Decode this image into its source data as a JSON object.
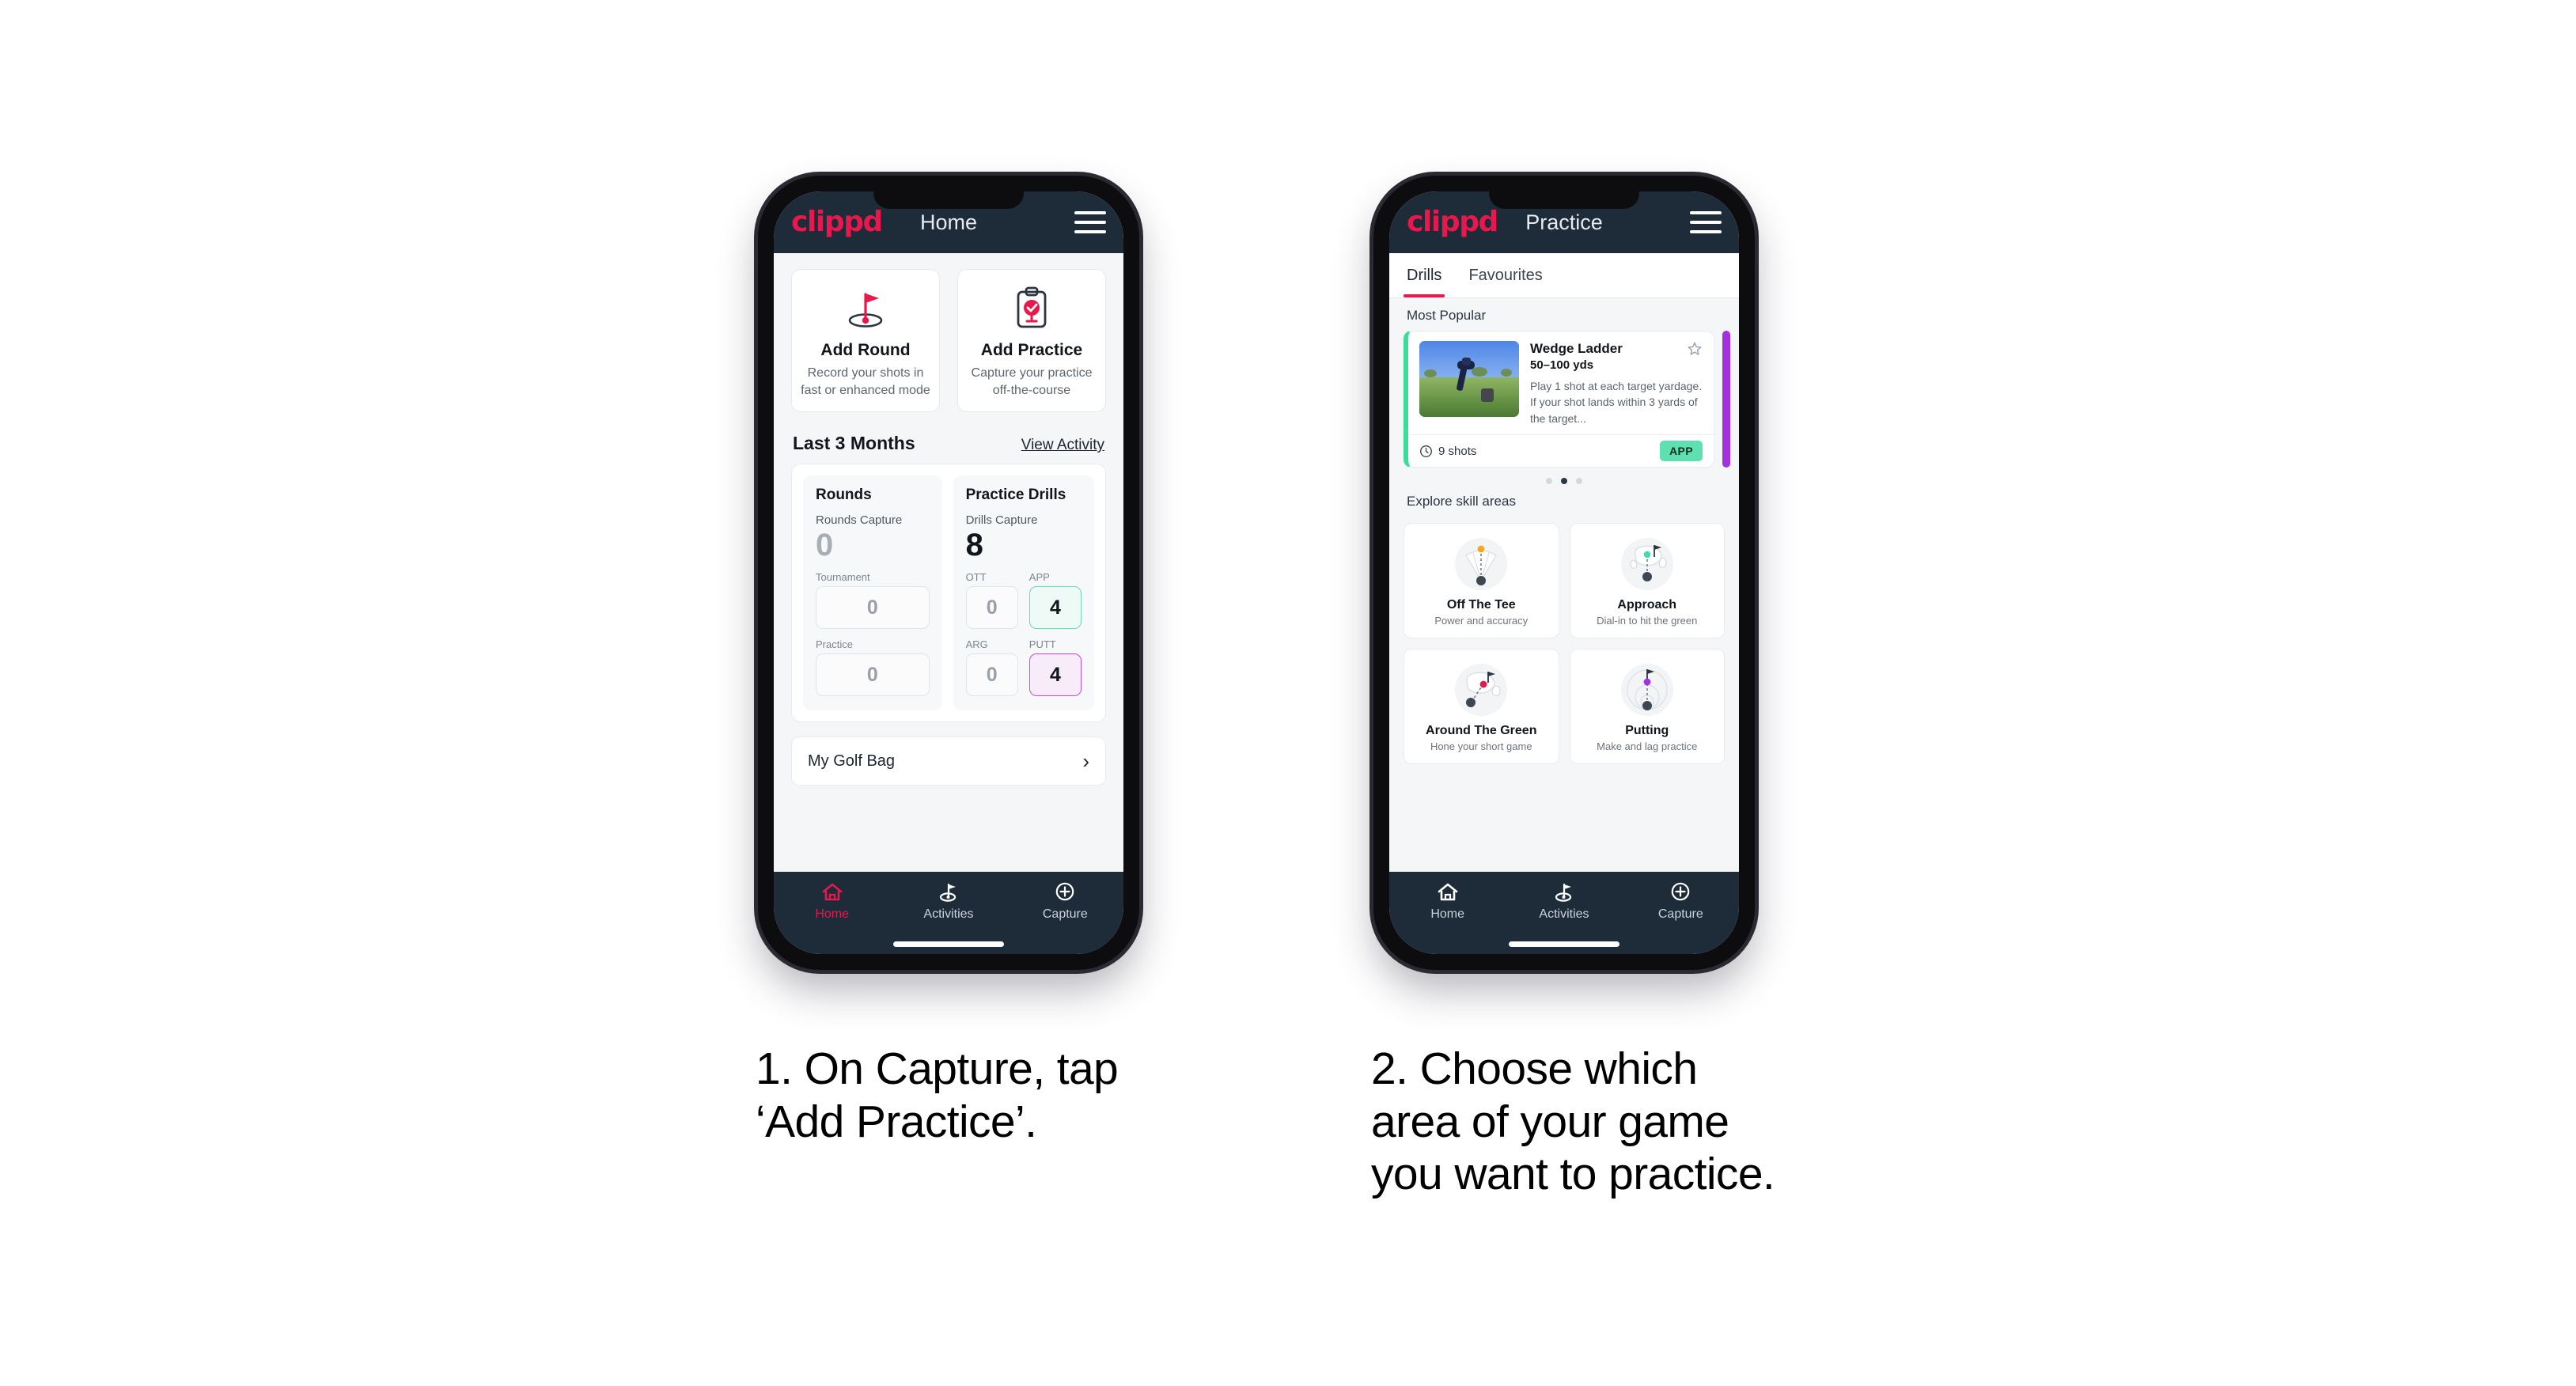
{
  "colors": {
    "brand_pink": "#e8174c",
    "appbar_dark": "#1e2c3a",
    "page_bg": "#f5f6f8",
    "accent_green": "#3ddc9a",
    "accent_purple": "#a431e0",
    "pill_green": "#5fe0b0"
  },
  "phone1": {
    "appbar": {
      "logo": "clippd",
      "title": "Home",
      "menu_icon": "hamburger-menu-icon"
    },
    "quick_actions": [
      {
        "icon": "golf-flag-hole-icon",
        "title": "Add Round",
        "subtitle": "Record your shots in fast or enhanced mode"
      },
      {
        "icon": "clipboard-check-tee-icon",
        "title": "Add Practice",
        "subtitle": "Capture your practice off-the-course"
      }
    ],
    "section": {
      "title": "Last 3 Months",
      "link": "View Activity"
    },
    "stats": {
      "rounds": {
        "heading": "Rounds",
        "capture_label": "Rounds Capture",
        "capture_value": "0",
        "metrics": [
          {
            "label": "Tournament",
            "value": "0",
            "state": "empty"
          },
          {
            "label": "Practice",
            "value": "0",
            "state": "empty"
          }
        ]
      },
      "drills": {
        "heading": "Practice Drills",
        "capture_label": "Drills Capture",
        "capture_value": "8",
        "metrics": [
          {
            "label": "OTT",
            "value": "0",
            "state": "empty"
          },
          {
            "label": "APP",
            "value": "4",
            "state": "green"
          },
          {
            "label": "ARG",
            "value": "0",
            "state": "empty"
          },
          {
            "label": "PUTT",
            "value": "4",
            "state": "purple"
          }
        ]
      }
    },
    "golf_bag": {
      "label": "My Golf Bag",
      "chevron": "chevron-right-icon"
    },
    "bottom_nav": [
      {
        "label": "Home",
        "icon": "home-icon",
        "active": true
      },
      {
        "label": "Activities",
        "icon": "golf-flag-icon",
        "active": false
      },
      {
        "label": "Capture",
        "icon": "plus-circle-icon",
        "active": false
      }
    ]
  },
  "phone2": {
    "appbar": {
      "logo": "clippd",
      "title": "Practice",
      "menu_icon": "hamburger-menu-icon"
    },
    "tabs": [
      {
        "label": "Drills",
        "selected": true
      },
      {
        "label": "Favourites",
        "selected": false
      }
    ],
    "most_popular_label": "Most Popular",
    "drill": {
      "name": "Wedge Ladder",
      "yardage": "50–100 yds",
      "description": "Play 1 shot at each target yardage. If your shot lands within 3 yards of the target...",
      "shots": "9 shots",
      "shots_icon": "clock-icon",
      "tag": "APP",
      "star_icon": "star-outline-icon",
      "thumbnail": "golfer-wedge-shot-photo"
    },
    "carousel_dots": [
      false,
      true,
      false
    ],
    "explore_label": "Explore skill areas",
    "skill_areas": [
      {
        "title": "Off The Tee",
        "subtitle": "Power and accuracy",
        "icon": "tee-shot-dispersion-icon"
      },
      {
        "title": "Approach",
        "subtitle": "Dial-in to hit the green",
        "icon": "approach-green-icon"
      },
      {
        "title": "Around The Green",
        "subtitle": "Hone your short game",
        "icon": "chip-around-green-icon"
      },
      {
        "title": "Putting",
        "subtitle": "Make and lag practice",
        "icon": "putting-rings-icon"
      }
    ],
    "bottom_nav": [
      {
        "label": "Home",
        "icon": "home-icon",
        "active": false
      },
      {
        "label": "Activities",
        "icon": "golf-flag-icon",
        "active": false
      },
      {
        "label": "Capture",
        "icon": "plus-circle-icon",
        "active": false
      }
    ]
  },
  "captions": {
    "step1": "1. On Capture, tap\n‘Add Practice’.",
    "step2": "2. Choose which\narea of your game\nyou want to practice."
  }
}
